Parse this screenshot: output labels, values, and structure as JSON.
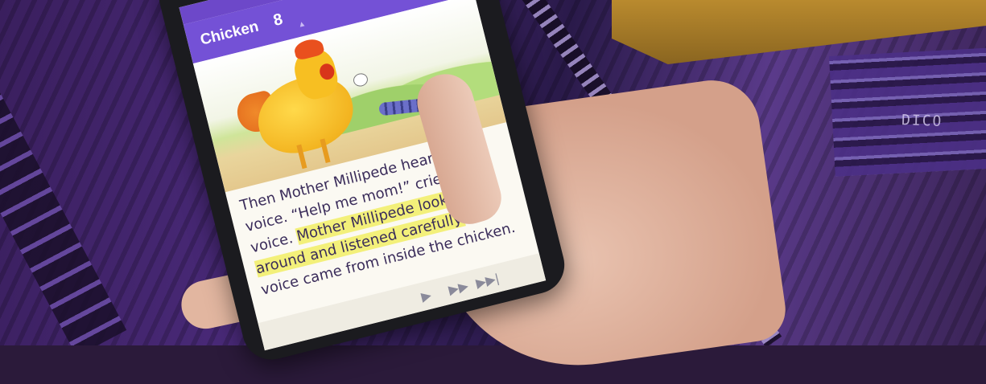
{
  "app": {
    "title": "Chicken",
    "page_number": "8",
    "page_caret": "▲",
    "icons": {
      "speaker": "speaker-icon",
      "search": "search-icon",
      "more": "more-vert-icon"
    },
    "status_icons": "▼◢"
  },
  "story": {
    "part1": "Then Mother Millipede heard a tiny voice. “Help me mom!” cried the voice. ",
    "highlight": "Mother Millipede looked around and listened carefully.",
    "part2": " The voice came from inside the chicken."
  },
  "controls": {
    "play": "▶",
    "fast_forward": "▶▶",
    "next": "▶▶|"
  },
  "background": {
    "weave_text": "DICO"
  },
  "colors": {
    "app_bar": "#7451d6",
    "status_bar": "#6d48c9",
    "highlight": "#f3f07a",
    "text": "#3a2c5a"
  }
}
